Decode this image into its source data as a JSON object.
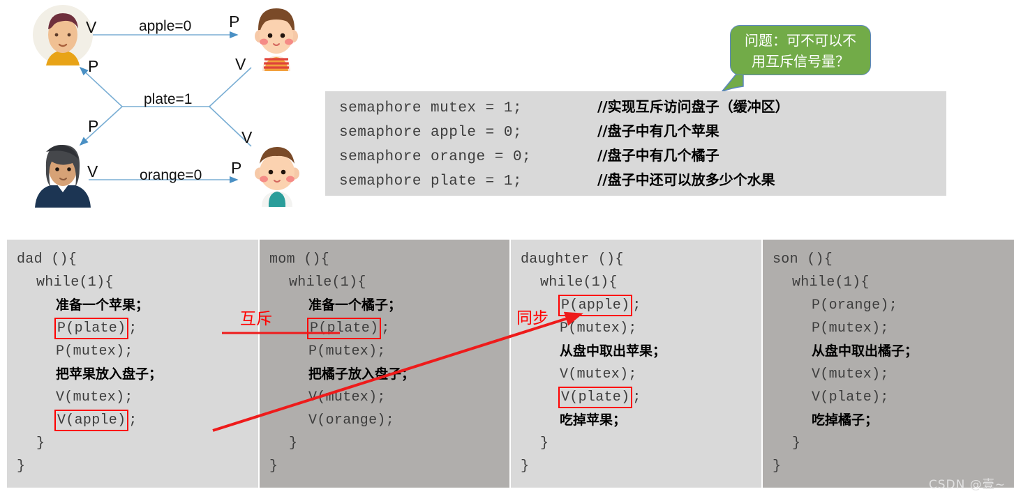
{
  "diagram": {
    "edges": [
      {
        "id": "apple",
        "label": "apple=0",
        "from_op": "V",
        "to_op": "P"
      },
      {
        "id": "plate",
        "label": "plate=1",
        "from_op": "P",
        "to_op": "V"
      },
      {
        "id": "orange",
        "label": "orange=0",
        "from_op": "V",
        "to_op": "P"
      }
    ],
    "op_labels": {
      "dad_v": "V",
      "daughter_p": "P",
      "daughter_v": "V",
      "dad_p": "P",
      "mom_p": "P",
      "son_v": "V",
      "mom_v": "V",
      "son_p": "P"
    },
    "actors": [
      {
        "id": "dad",
        "icon": "man-avatar-icon"
      },
      {
        "id": "daughter",
        "icon": "girl-avatar-icon"
      },
      {
        "id": "mom",
        "icon": "woman-avatar-icon"
      },
      {
        "id": "son",
        "icon": "boy-avatar-icon"
      }
    ]
  },
  "callout": {
    "line1": "问题：可不可以不",
    "line2": "用互斥信号量？",
    "bg_color": "#72ab48",
    "border_color": "#5c86c0"
  },
  "semaphores": [
    {
      "code": "semaphore mutex = 1;",
      "comment": "//实现互斥访问盘子（缓冲区）"
    },
    {
      "code": "semaphore apple = 0;",
      "comment": "//盘子中有几个苹果"
    },
    {
      "code": "semaphore orange = 0;",
      "comment": "//盘子中有几个橘子"
    },
    {
      "code": "semaphore plate = 1;",
      "comment": "//盘子中还可以放多少个水果"
    }
  ],
  "processes": [
    {
      "id": "dad",
      "shade": "light",
      "lines": [
        {
          "indent": 0,
          "text": "dad (){",
          "cn": false,
          "boxed": false
        },
        {
          "indent": 1,
          "text": "while(1){",
          "cn": false,
          "boxed": false
        },
        {
          "indent": 2,
          "text": "准备一个苹果；",
          "cn": true,
          "boxed": false
        },
        {
          "indent": 2,
          "text": "P(plate)",
          "cn": false,
          "boxed": true,
          "tail": ";"
        },
        {
          "indent": 2,
          "text": "P(mutex);",
          "cn": false,
          "boxed": false
        },
        {
          "indent": 2,
          "text": "把苹果放入盘子；",
          "cn": true,
          "boxed": false
        },
        {
          "indent": 2,
          "text": "V(mutex);",
          "cn": false,
          "boxed": false
        },
        {
          "indent": 2,
          "text": "V(apple)",
          "cn": false,
          "boxed": true,
          "tail": ";"
        },
        {
          "indent": 1,
          "text": "}",
          "cn": false,
          "boxed": false
        },
        {
          "indent": 0,
          "text": "}",
          "cn": false,
          "boxed": false
        }
      ]
    },
    {
      "id": "mom",
      "shade": "dark",
      "lines": [
        {
          "indent": 0,
          "text": "mom (){",
          "cn": false,
          "boxed": false
        },
        {
          "indent": 1,
          "text": "while(1){",
          "cn": false,
          "boxed": false
        },
        {
          "indent": 2,
          "text": "准备一个橘子；",
          "cn": true,
          "boxed": false
        },
        {
          "indent": 2,
          "text": "P(plate)",
          "cn": false,
          "boxed": true,
          "tail": ";"
        },
        {
          "indent": 2,
          "text": "P(mutex);",
          "cn": false,
          "boxed": false
        },
        {
          "indent": 2,
          "text": "把橘子放入盘子；",
          "cn": true,
          "boxed": false
        },
        {
          "indent": 2,
          "text": "V(mutex);",
          "cn": false,
          "boxed": false
        },
        {
          "indent": 2,
          "text": "V(orange);",
          "cn": false,
          "boxed": false
        },
        {
          "indent": 1,
          "text": "}",
          "cn": false,
          "boxed": false
        },
        {
          "indent": 0,
          "text": "}",
          "cn": false,
          "boxed": false
        }
      ]
    },
    {
      "id": "daughter",
      "shade": "light",
      "lines": [
        {
          "indent": 0,
          "text": "daughter (){",
          "cn": false,
          "boxed": false
        },
        {
          "indent": 1,
          "text": "while(1){",
          "cn": false,
          "boxed": false
        },
        {
          "indent": 2,
          "text": "P(apple)",
          "cn": false,
          "boxed": true,
          "tail": ";"
        },
        {
          "indent": 2,
          "text": "P(mutex);",
          "cn": false,
          "boxed": false
        },
        {
          "indent": 2,
          "text": "从盘中取出苹果；",
          "cn": true,
          "boxed": false
        },
        {
          "indent": 2,
          "text": "V(mutex);",
          "cn": false,
          "boxed": false
        },
        {
          "indent": 2,
          "text": "V(plate)",
          "cn": false,
          "boxed": true,
          "tail": ";"
        },
        {
          "indent": 2,
          "text": "吃掉苹果；",
          "cn": true,
          "boxed": false
        },
        {
          "indent": 1,
          "text": "}",
          "cn": false,
          "boxed": false
        },
        {
          "indent": 0,
          "text": "}",
          "cn": false,
          "boxed": false
        }
      ]
    },
    {
      "id": "son",
      "shade": "dark",
      "lines": [
        {
          "indent": 0,
          "text": "son (){",
          "cn": false,
          "boxed": false
        },
        {
          "indent": 1,
          "text": "while(1){",
          "cn": false,
          "boxed": false
        },
        {
          "indent": 2,
          "text": "P(orange);",
          "cn": false,
          "boxed": false
        },
        {
          "indent": 2,
          "text": "P(mutex);",
          "cn": false,
          "boxed": false
        },
        {
          "indent": 2,
          "text": "从盘中取出橘子；",
          "cn": true,
          "boxed": false
        },
        {
          "indent": 2,
          "text": "V(mutex);",
          "cn": false,
          "boxed": false
        },
        {
          "indent": 2,
          "text": "V(plate);",
          "cn": false,
          "boxed": false
        },
        {
          "indent": 2,
          "text": "吃掉橘子；",
          "cn": true,
          "boxed": false
        },
        {
          "indent": 1,
          "text": "}",
          "cn": false,
          "boxed": false
        },
        {
          "indent": 0,
          "text": "}",
          "cn": false,
          "boxed": false
        }
      ]
    }
  ],
  "annotations": [
    {
      "id": "mutual-exclusion",
      "label": "互斥",
      "color": "#ff0000"
    },
    {
      "id": "synchronization",
      "label": "同步",
      "color": "#ff0000"
    }
  ],
  "watermark": "CSDN @壹~"
}
